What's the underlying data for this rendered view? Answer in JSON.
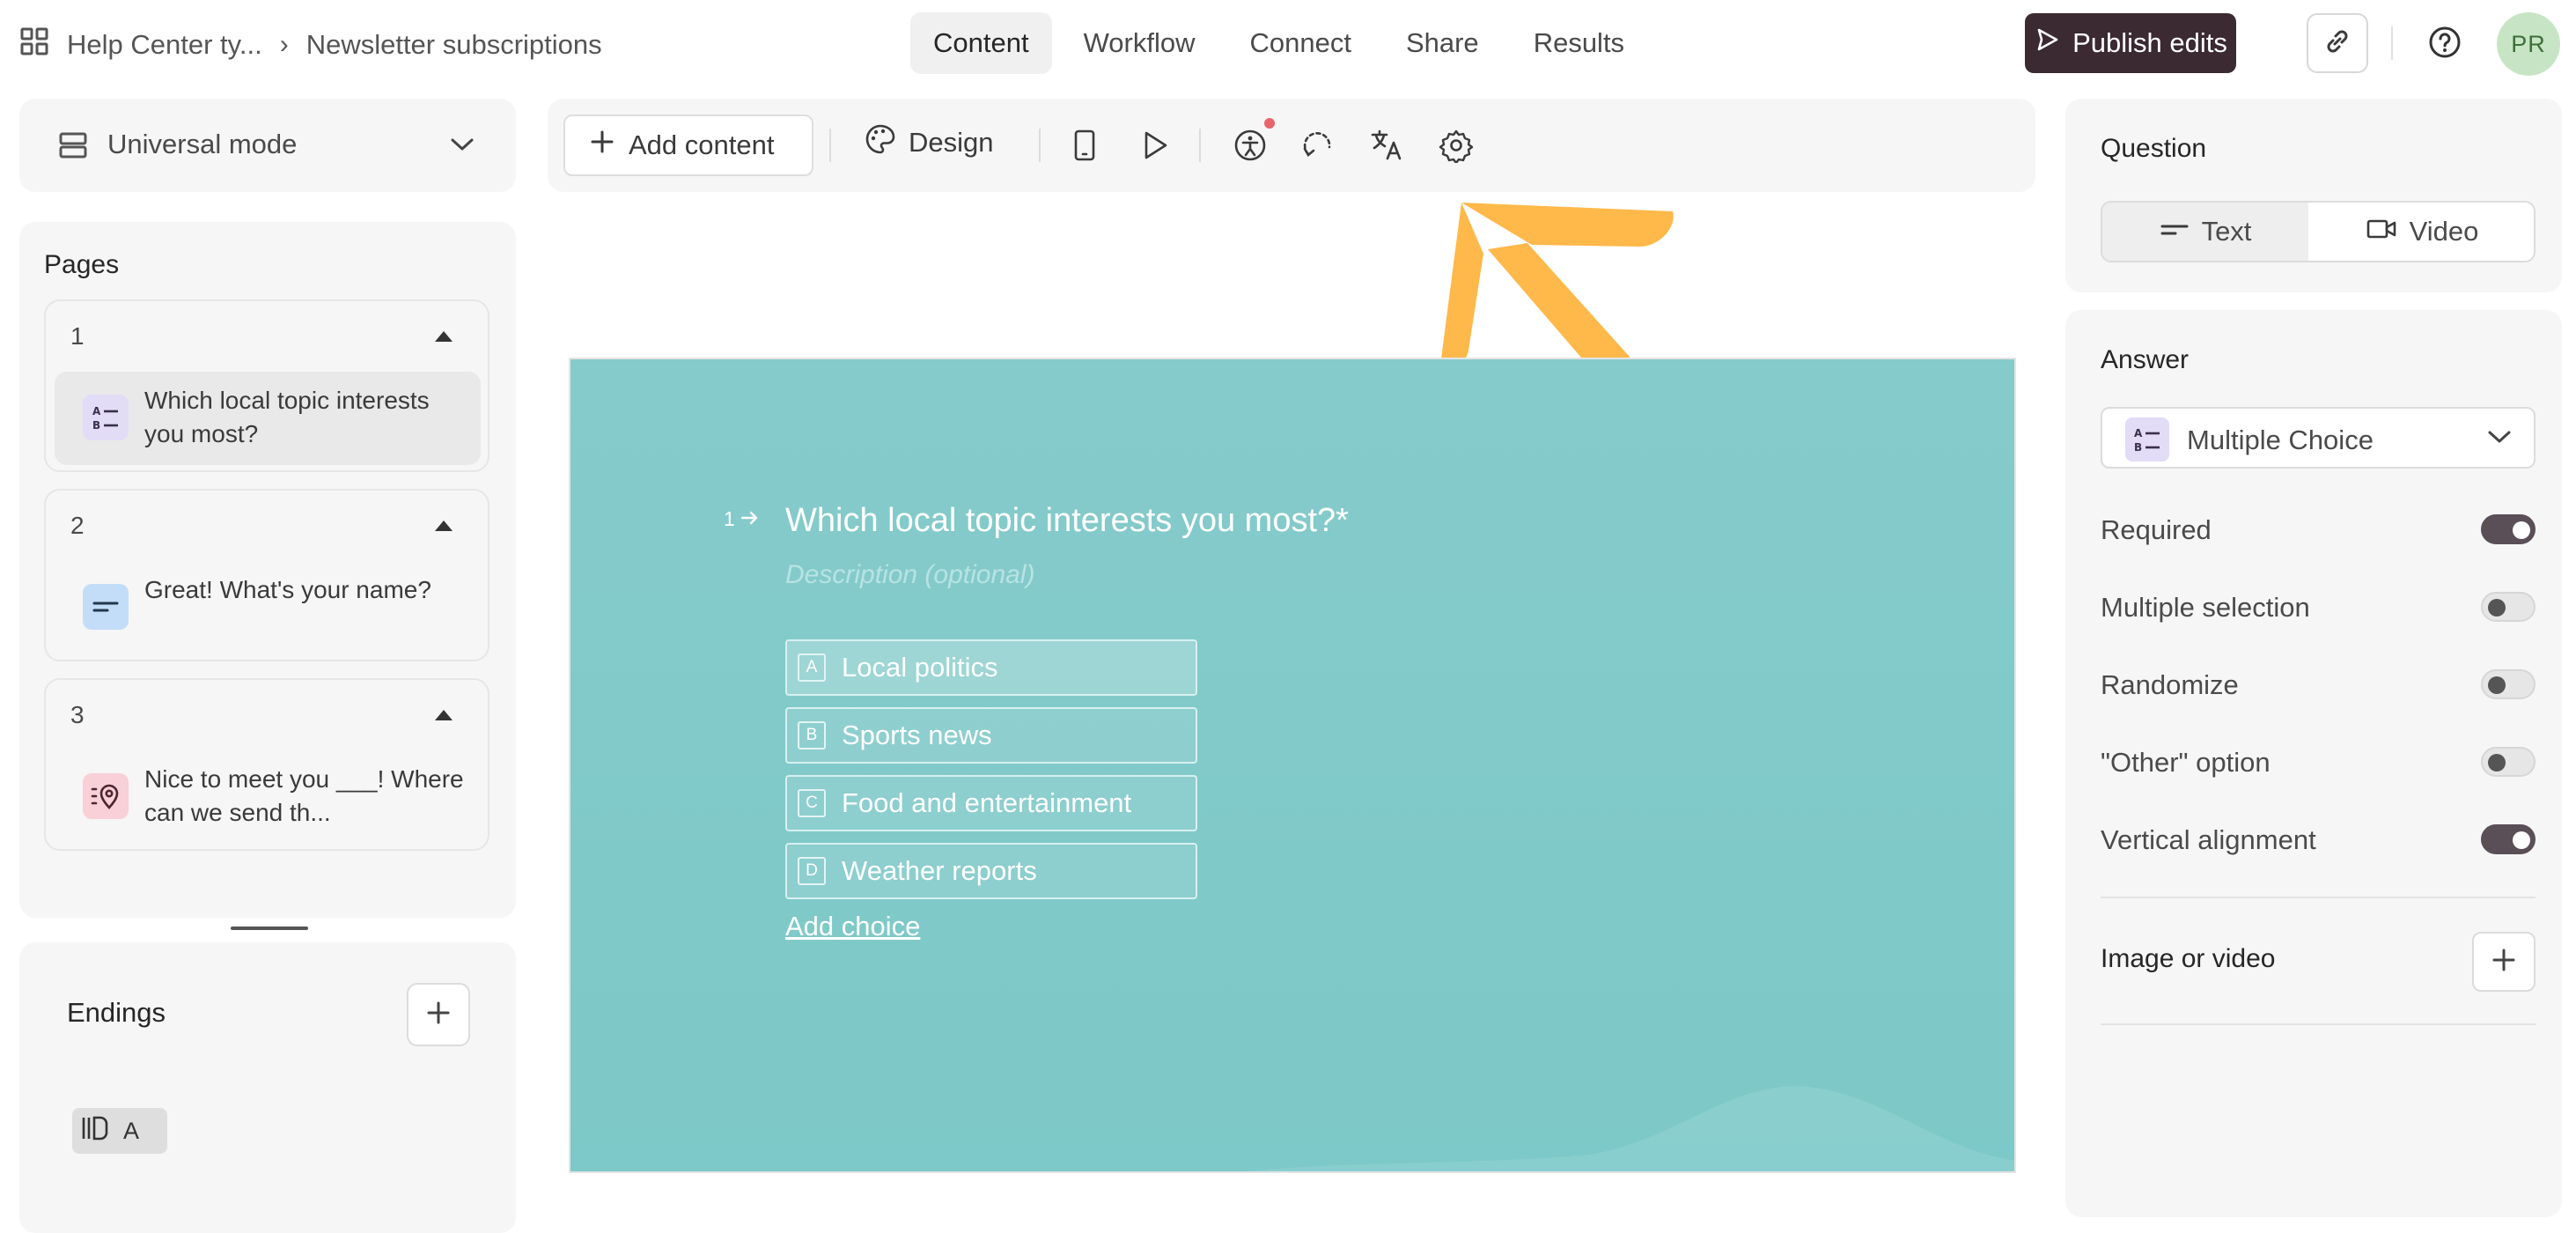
{
  "header": {
    "breadcrumb_first": "Help Center ty...",
    "breadcrumb_sep": "›",
    "breadcrumb_current": "Newsletter subscriptions",
    "tabs": [
      "Content",
      "Workflow",
      "Connect",
      "Share",
      "Results"
    ],
    "active_tab": "Content",
    "publish_label": "Publish edits",
    "avatar_initials": "PR"
  },
  "sidebar": {
    "mode_label": "Universal mode",
    "pages_title": "Pages",
    "pages": [
      {
        "number": "1",
        "text": "Which local topic interests you most?",
        "icon": "multiple-choice-icon",
        "selected": true
      },
      {
        "number": "2",
        "text": "Great! What's your name?",
        "icon": "short-text-icon",
        "selected": false
      },
      {
        "number": "3",
        "text": "Nice to meet you ___! Where can we send th...",
        "icon": "address-icon",
        "selected": false
      }
    ],
    "endings_title": "Endings",
    "ending_chip_label": "A"
  },
  "toolbar": {
    "add_content_label": "Add content",
    "design_label": "Design",
    "icons": [
      "mobile-preview-icon",
      "play-icon",
      "accessibility-icon",
      "logic-icon",
      "translate-icon",
      "settings-icon"
    ]
  },
  "canvas": {
    "question_number": "1",
    "question_title": "Which local topic interests you most?*",
    "description_placeholder": "Description (optional)",
    "choices": [
      {
        "key": "A",
        "label": "Local politics"
      },
      {
        "key": "B",
        "label": "Sports news"
      },
      {
        "key": "C",
        "label": "Food and entertainment"
      },
      {
        "key": "D",
        "label": "Weather reports"
      }
    ],
    "add_choice_label": "Add choice",
    "background_color": "#82caca"
  },
  "right_panel": {
    "question_title": "Question",
    "question_types": [
      "Text",
      "Video"
    ],
    "active_question_type": "Text",
    "answer_title": "Answer",
    "answer_type": "Multiple Choice",
    "settings": [
      {
        "label": "Required",
        "on": true
      },
      {
        "label": "Multiple selection",
        "on": false
      },
      {
        "label": "Randomize",
        "on": false
      },
      {
        "label": "\"Other\" option",
        "on": false
      },
      {
        "label": "Vertical alignment",
        "on": true
      }
    ],
    "image_or_video_label": "Image or video"
  },
  "colors": {
    "publish_bg": "#3b2a32",
    "highlight_arrow": "#ffb84a",
    "notification_dot": "#e8646a",
    "avatar_bg": "#c7e5c4"
  }
}
